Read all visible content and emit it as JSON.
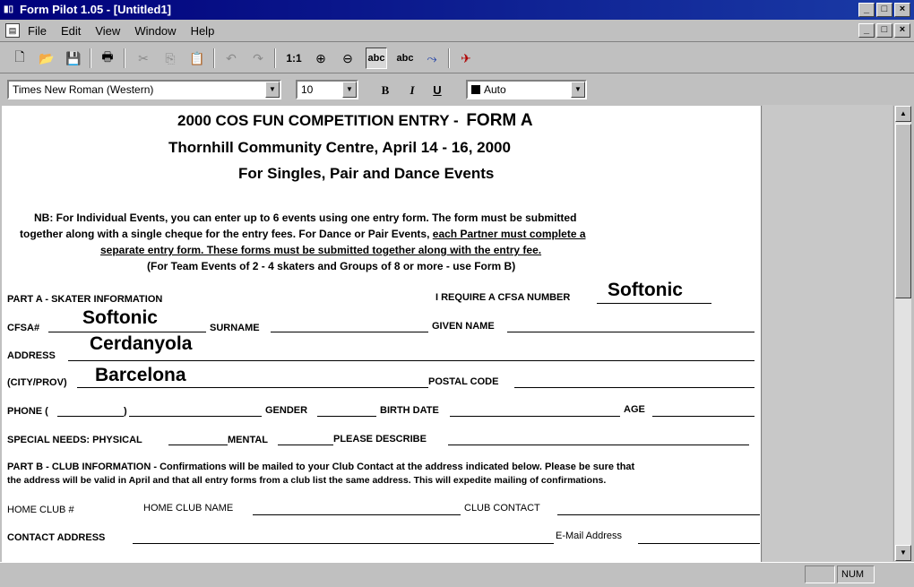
{
  "window": {
    "title": "Form Pilot 1.05 - [Untitled1]",
    "min": "_",
    "max": "□",
    "close": "×"
  },
  "menu": {
    "items": [
      "File",
      "Edit",
      "View",
      "Window",
      "Help"
    ]
  },
  "toolbar": {
    "zoom_1to1": "1:1",
    "text_btn_1": "abc",
    "text_btn_2": "abc"
  },
  "format": {
    "font": "Times New Roman (Western)",
    "size": "10",
    "bold": "B",
    "italic": "I",
    "underline": "U",
    "color": "Auto"
  },
  "form": {
    "title": "2000 COS FUN COMPETITION ENTRY - ",
    "title_form": "FORM A",
    "subtitle": "Thornhill Community Centre, April 14 - 16, 2000",
    "subtitle2": "For Singles, Pair and Dance Events",
    "nb1": "NB:  For Individual Events, you can enter up to 6 events using one entry form.  The form must be submitted",
    "nb2a": "together along with a single cheque for the entry fees.   For Dance or Pair Events, ",
    "nb2b": "each Partner must complete a",
    "nb3": "separate entry form.  These forms  must be submitted together along with the entry fee.",
    "nb4": "(For Team Events of 2 - 4 skaters and Groups of 8 or more - use Form B)",
    "part_a": "PART A - SKATER INFORMATION",
    "cfsa_require": "I REQUIRE A CFSA NUMBER",
    "cfsa_label": "CFSA#",
    "surname": "SURNAME",
    "given_name": "GIVEN NAME",
    "address": "ADDRESS",
    "city": "(CITY/PROV)",
    "postal": "POSTAL CODE",
    "phone": "PHONE (",
    "phone_close": ")",
    "gender": "GENDER",
    "birth": "BIRTH DATE",
    "age": "AGE",
    "special": "SPECIAL NEEDS:  PHYSICAL",
    "mental": "MENTAL",
    "describe": "PLEASE DESCRIBE",
    "part_b": "PART B - CLUB INFORMATION",
    "part_b_text": " - Confirmations will be mailed to your Club Contact at the address indicated below.  Please be sure that",
    "part_b_text2": "the address will be valid in April and that all entry forms from a club list the same address.  This will expedite mailing of confirmations.",
    "home_club_no": "HOME CLUB #",
    "home_club_name": "HOME CLUB NAME",
    "club_contact": "CLUB CONTACT",
    "contact_address": "CONTACT ADDRESS",
    "email": "E-Mail Address",
    "fill_require": "Softonic",
    "fill_cfsa": "Softonic",
    "fill_address": "Cerdanyola",
    "fill_city": "Barcelona"
  },
  "status": {
    "num": "NUM"
  }
}
